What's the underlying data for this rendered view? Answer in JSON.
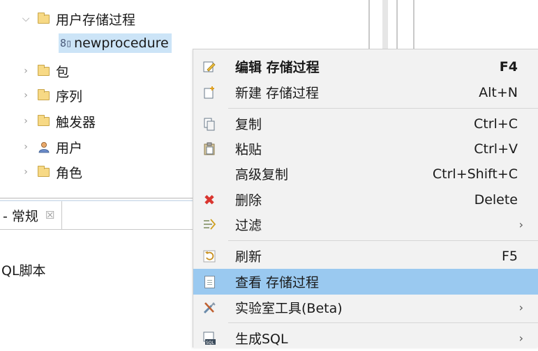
{
  "tree": {
    "user_procedures_label": "用户存储过程",
    "procedure_label": "newprocedure",
    "items": [
      {
        "label": "包",
        "icon": "folder-icon"
      },
      {
        "label": "序列",
        "icon": "folder-icon"
      },
      {
        "label": "触发器",
        "icon": "folder-icon"
      },
      {
        "label": "用户",
        "icon": "user-icon"
      },
      {
        "label": "角色",
        "icon": "folder-icon"
      }
    ],
    "partial_label": "..."
  },
  "panel": {
    "tab_label": "- 常规",
    "tab_close": "☒",
    "body_text": "QL脚本"
  },
  "context_menu": {
    "items": [
      {
        "label": "编辑 存储过程",
        "shortcut": "F4",
        "icon": "edit-icon",
        "bold": true
      },
      {
        "label": "新建 存储过程",
        "shortcut": "Alt+N",
        "icon": "new-icon"
      },
      {
        "label": "复制",
        "shortcut": "Ctrl+C",
        "icon": "copy-icon"
      },
      {
        "label": "粘贴",
        "shortcut": "Ctrl+V",
        "icon": "paste-icon"
      },
      {
        "label": "高级复制",
        "shortcut": "Ctrl+Shift+C",
        "icon": ""
      },
      {
        "label": "删除",
        "shortcut": "Delete",
        "icon": "delete-icon"
      },
      {
        "label": "过滤",
        "shortcut": "",
        "icon": "filter-icon",
        "submenu": true
      },
      {
        "label": "刷新",
        "shortcut": "F5",
        "icon": "refresh-icon"
      },
      {
        "label": "查看 存储过程",
        "shortcut": "",
        "icon": "view-icon",
        "highlighted": true
      },
      {
        "label": "实验室工具(Beta)",
        "shortcut": "",
        "icon": "tools-icon",
        "submenu": true
      },
      {
        "label": "生成SQL",
        "shortcut": "",
        "icon": "sql-icon",
        "submenu": true
      }
    ],
    "submenu_arrow": "›"
  },
  "colors": {
    "menu_bg": "#f2f2f2",
    "highlight": "#9ac9f0",
    "selection": "#cce4f7",
    "folder": "#f7d985",
    "delete": "#d9352f"
  }
}
